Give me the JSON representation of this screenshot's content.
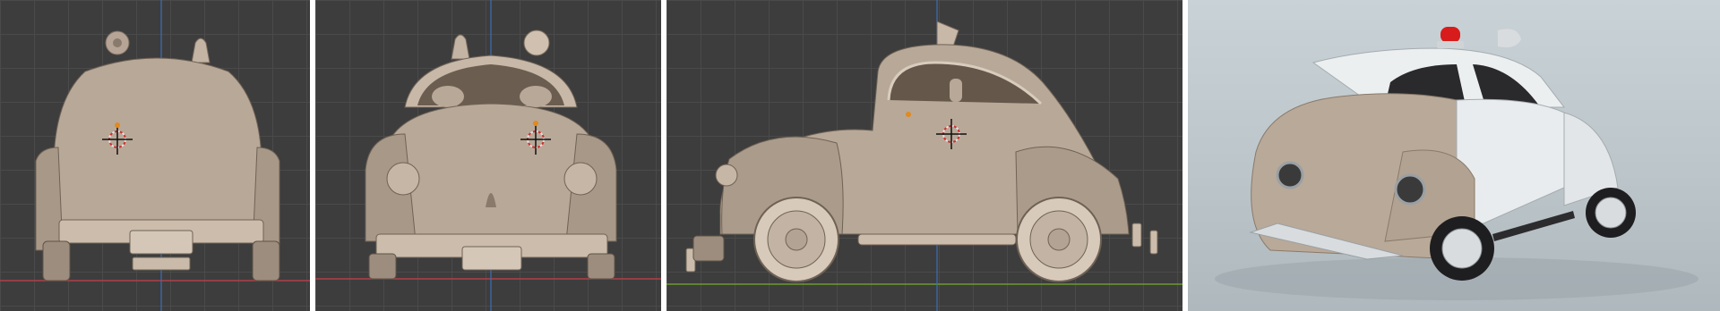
{
  "panels": [
    {
      "view": "rear-view",
      "kind": "viewport"
    },
    {
      "view": "front-view",
      "kind": "viewport"
    },
    {
      "view": "side-view",
      "kind": "viewport"
    },
    {
      "view": "render",
      "kind": "render"
    }
  ],
  "colors": {
    "viewport_bg": "#3d3d3d",
    "grid_line": "#4a4a4a",
    "x_axis": "#b04048",
    "y_axis_green": "#6c9a2e",
    "z_axis": "#3d6fb8",
    "car_body": "#b8a898",
    "car_shadow": "#8a7a6b",
    "siren_red": "#d81c1c",
    "render_white": "#e8ecee"
  },
  "icons": [
    "3d-cursor-icon",
    "origin-dot-icon",
    "siren-light-icon",
    "loudspeaker-icon"
  ]
}
